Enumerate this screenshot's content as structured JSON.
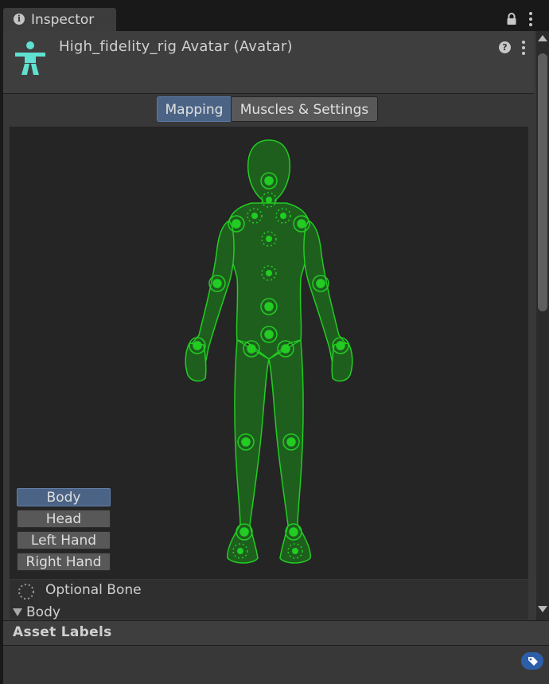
{
  "window": {
    "tab_title": "Inspector",
    "tab_icon": "info-icon"
  },
  "header": {
    "asset_title": "High_fidelity_rig Avatar (Avatar)",
    "icon": "avatar-icon"
  },
  "mode_tabs": [
    {
      "label": "Mapping",
      "selected": true
    },
    {
      "label": "Muscles & Settings",
      "selected": false
    }
  ],
  "body_parts": [
    {
      "label": "Body",
      "selected": true
    },
    {
      "label": "Head",
      "selected": false
    },
    {
      "label": "Left Hand",
      "selected": false
    },
    {
      "label": "Right Hand",
      "selected": false
    }
  ],
  "legend": {
    "optional_label": "Optional Bone"
  },
  "foldout": {
    "label": "Body",
    "expanded": true
  },
  "asset_labels": {
    "title": "Asset Labels"
  },
  "colors": {
    "accent_selected": "#4b6485",
    "figure_stroke": "#22cc22",
    "figure_fill": "#1e5f1e",
    "tag_button": "#2d5ea8",
    "avatar_icon": "#5fe0d0"
  }
}
